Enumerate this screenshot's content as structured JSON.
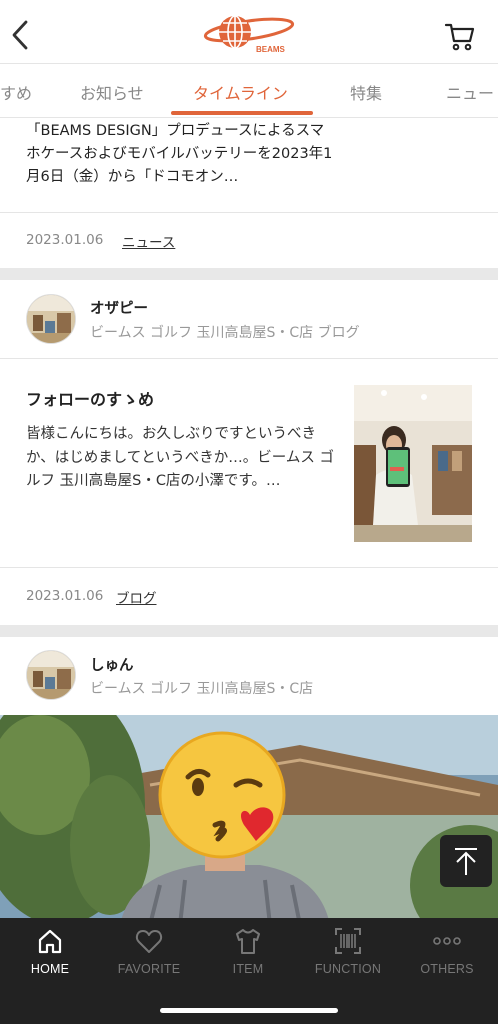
{
  "header": {
    "logo_text": "BEAMS",
    "brand_color": "#e0653a"
  },
  "tabs": [
    {
      "label": "すめ"
    },
    {
      "label": "お知らせ"
    },
    {
      "label": "タイムライン",
      "active": true
    },
    {
      "label": "特集"
    },
    {
      "label": "ニュー"
    }
  ],
  "feed": {
    "item1": {
      "excerpt": "「BEAMS DESIGN」プロデュースによるスマホケースおよびモバイルバッテリーを2023年1月6日（金）から「ドコモオン…",
      "date": "2023.01.06",
      "category": "ニュース"
    },
    "item2": {
      "author_name": "オザピー",
      "author_shop": "ビームス ゴルフ 玉川高島屋S・C店 ブログ",
      "title": "フォローのすゝめ",
      "excerpt": "皆様こんにちは。お久しぶりですというべきか、はじめましてというべきか…。ビームス ゴルフ 玉川高島屋S・C店の小澤です。…",
      "date": "2023.01.06",
      "category": "ブログ"
    },
    "item3": {
      "author_name": "しゅん",
      "author_shop": "ビームス ゴルフ 玉川高島屋S・C店"
    }
  },
  "bottom_nav": [
    {
      "label": "HOME",
      "icon": "home-icon",
      "active": true
    },
    {
      "label": "FAVORITE",
      "icon": "heart-icon"
    },
    {
      "label": "ITEM",
      "icon": "tshirt-icon"
    },
    {
      "label": "FUNCTION",
      "icon": "barcode-icon"
    },
    {
      "label": "OTHERS",
      "icon": "more-icon"
    }
  ]
}
